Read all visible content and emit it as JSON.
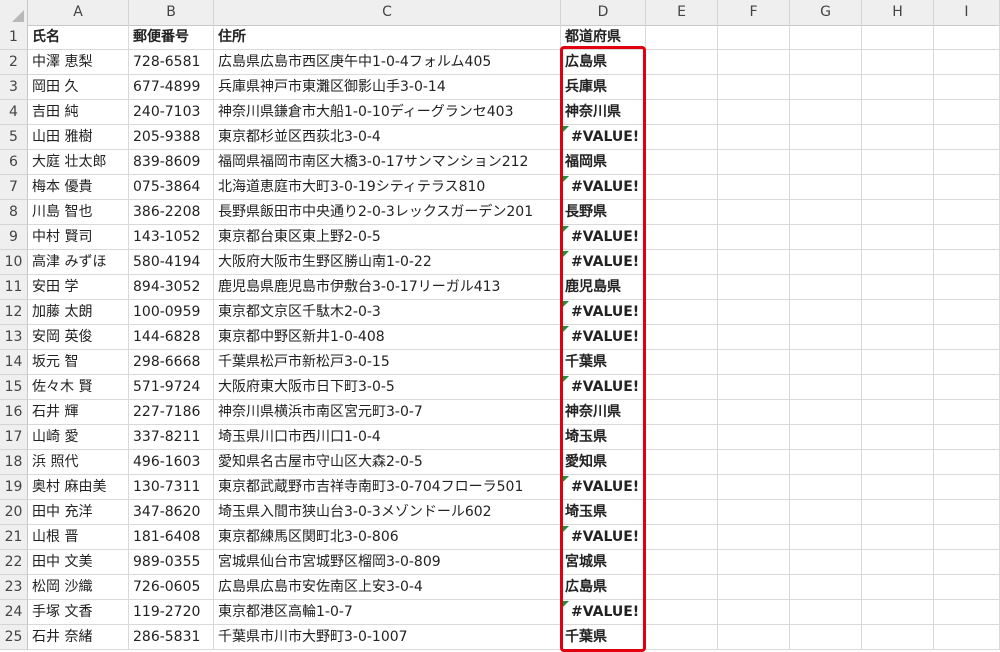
{
  "columns": [
    "A",
    "B",
    "C",
    "D",
    "E",
    "F",
    "G",
    "H",
    "I"
  ],
  "header": {
    "num": "1",
    "name": "氏名",
    "postal": "郵便番号",
    "address": "住所",
    "pref": "都道府県"
  },
  "rows": [
    {
      "num": "2",
      "name": "中澤 恵梨",
      "postal": "728-6581",
      "address": "広島県広島市西区庚午中1-0-4フォルム405",
      "pref": "広島県",
      "error": false
    },
    {
      "num": "3",
      "name": "岡田 久",
      "postal": "677-4899",
      "address": "兵庫県神戸市東灘区御影山手3-0-14",
      "pref": "兵庫県",
      "error": false
    },
    {
      "num": "4",
      "name": "吉田 純",
      "postal": "240-7103",
      "address": "神奈川県鎌倉市大船1-0-10ディーグランセ403",
      "pref": "神奈川県",
      "error": false
    },
    {
      "num": "5",
      "name": "山田 雅樹",
      "postal": "205-9388",
      "address": "東京都杉並区西荻北3-0-4",
      "pref": "#VALUE!",
      "error": true
    },
    {
      "num": "6",
      "name": "大庭 壮太郎",
      "postal": "839-8609",
      "address": "福岡県福岡市南区大橋3-0-17サンマンション212",
      "pref": "福岡県",
      "error": false
    },
    {
      "num": "7",
      "name": "梅本 優貴",
      "postal": "075-3864",
      "address": "北海道恵庭市大町3-0-19シティテラス810",
      "pref": "#VALUE!",
      "error": true
    },
    {
      "num": "8",
      "name": "川島 智也",
      "postal": "386-2208",
      "address": "長野県飯田市中央通り2-0-3レックスガーデン201",
      "pref": "長野県",
      "error": false
    },
    {
      "num": "9",
      "name": "中村 賢司",
      "postal": "143-1052",
      "address": "東京都台東区東上野2-0-5",
      "pref": "#VALUE!",
      "error": true
    },
    {
      "num": "10",
      "name": "高津 みずほ",
      "postal": "580-4194",
      "address": "大阪府大阪市生野区勝山南1-0-22",
      "pref": "#VALUE!",
      "error": true
    },
    {
      "num": "11",
      "name": "安田 学",
      "postal": "894-3052",
      "address": "鹿児島県鹿児島市伊敷台3-0-17リーガル413",
      "pref": "鹿児島県",
      "error": false
    },
    {
      "num": "12",
      "name": "加藤 太朗",
      "postal": "100-0959",
      "address": "東京都文京区千駄木2-0-3",
      "pref": "#VALUE!",
      "error": true
    },
    {
      "num": "13",
      "name": "安岡 英俊",
      "postal": "144-6828",
      "address": "東京都中野区新井1-0-408",
      "pref": "#VALUE!",
      "error": true
    },
    {
      "num": "14",
      "name": "坂元 智",
      "postal": "298-6668",
      "address": "千葉県松戸市新松戸3-0-15",
      "pref": "千葉県",
      "error": false
    },
    {
      "num": "15",
      "name": "佐々木 賢",
      "postal": "571-9724",
      "address": "大阪府東大阪市日下町3-0-5",
      "pref": "#VALUE!",
      "error": true
    },
    {
      "num": "16",
      "name": "石井 輝",
      "postal": "227-7186",
      "address": "神奈川県横浜市南区宮元町3-0-7",
      "pref": "神奈川県",
      "error": false
    },
    {
      "num": "17",
      "name": "山崎 愛",
      "postal": "337-8211",
      "address": "埼玉県川口市西川口1-0-4",
      "pref": "埼玉県",
      "error": false
    },
    {
      "num": "18",
      "name": "浜 照代",
      "postal": "496-1603",
      "address": "愛知県名古屋市守山区大森2-0-5",
      "pref": "愛知県",
      "error": false
    },
    {
      "num": "19",
      "name": "奥村 麻由美",
      "postal": "130-7311",
      "address": "東京都武蔵野市吉祥寺南町3-0-704フローラ501",
      "pref": "#VALUE!",
      "error": true
    },
    {
      "num": "20",
      "name": "田中 充洋",
      "postal": "347-8620",
      "address": "埼玉県入間市狭山台3-0-3メゾンドール602",
      "pref": "埼玉県",
      "error": false
    },
    {
      "num": "21",
      "name": "山根 晋",
      "postal": "181-6408",
      "address": "東京都練馬区関町北3-0-806",
      "pref": "#VALUE!",
      "error": true
    },
    {
      "num": "22",
      "name": "田中 文美",
      "postal": "989-0355",
      "address": "宮城県仙台市宮城野区榴岡3-0-809",
      "pref": "宮城県",
      "error": false
    },
    {
      "num": "23",
      "name": "松岡 沙織",
      "postal": "726-0605",
      "address": "広島県広島市安佐南区上安3-0-4",
      "pref": "広島県",
      "error": false
    },
    {
      "num": "24",
      "name": "手塚 文香",
      "postal": "119-2720",
      "address": "東京都港区高輪1-0-7",
      "pref": "#VALUE!",
      "error": true
    },
    {
      "num": "25",
      "name": "石井 奈緒",
      "postal": "286-5831",
      "address": "千葉県市川市大野町3-0-1007",
      "pref": "千葉県",
      "error": false
    }
  ]
}
